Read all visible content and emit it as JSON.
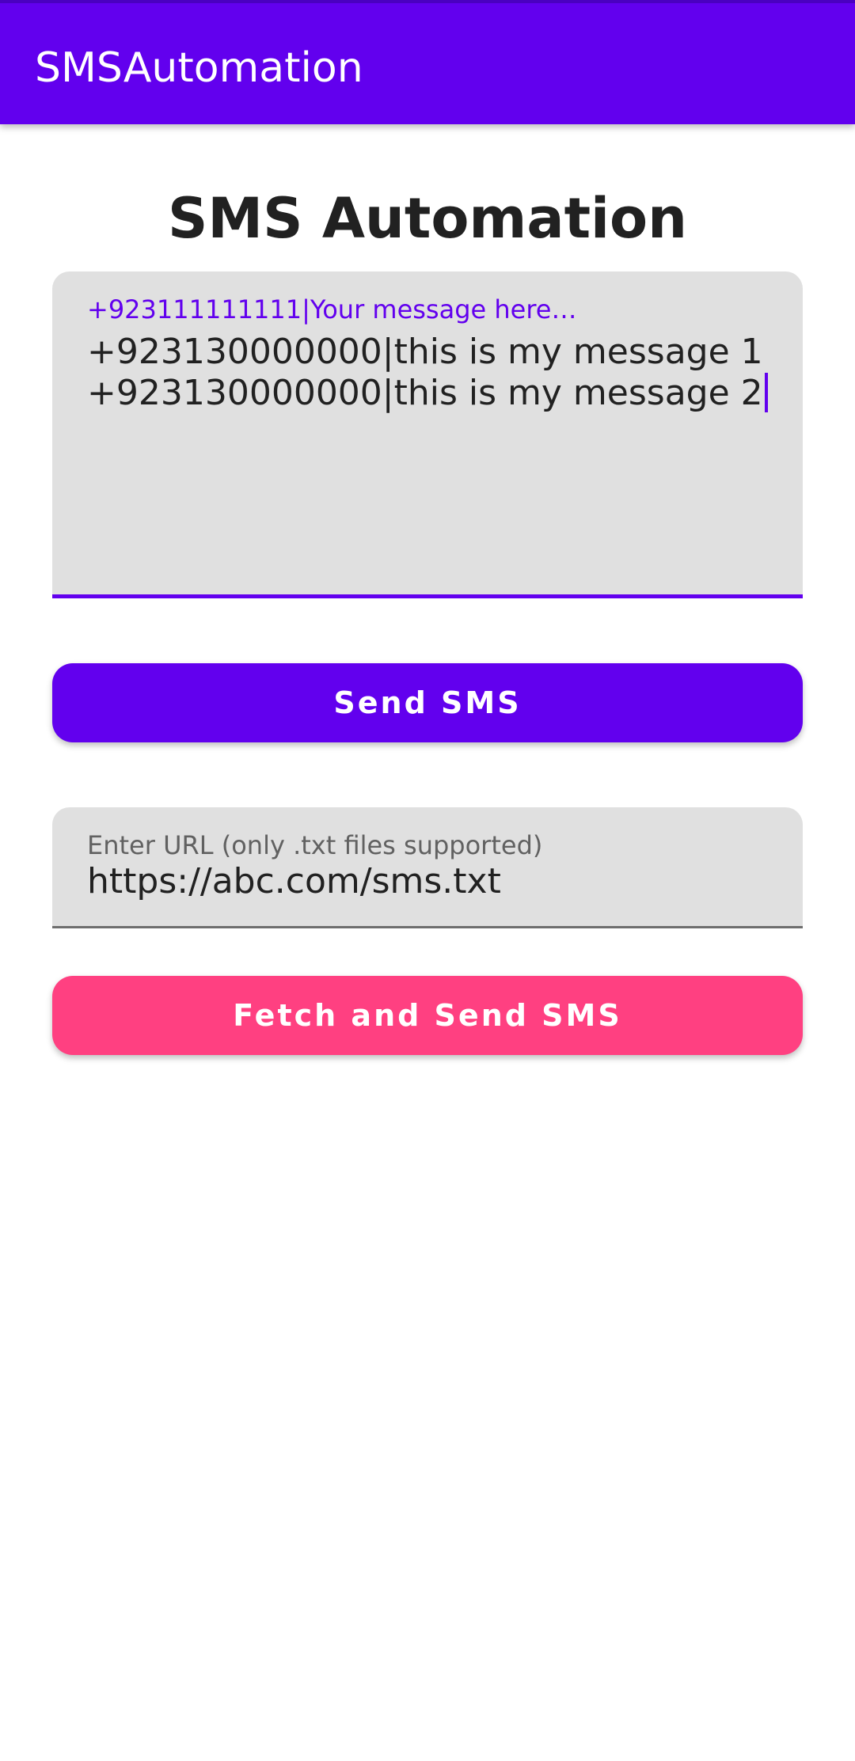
{
  "app_bar": {
    "title": "SMSAutomation"
  },
  "main": {
    "title": "SMS Automation",
    "messages_field": {
      "label": "+923111111111|Your message here…",
      "line1": "+923130000000|this is my message 1",
      "line2": "+923130000000|this is my message 2"
    },
    "send_button_label": "Send SMS",
    "url_field": {
      "label": "Enter URL (only .txt files supported)",
      "value": "https://abc.com/sms.txt"
    },
    "fetch_button_label": "Fetch and Send SMS"
  },
  "colors": {
    "primary": "#6200ee",
    "accent": "#ff4081",
    "field_background": "#e0e0e0"
  }
}
